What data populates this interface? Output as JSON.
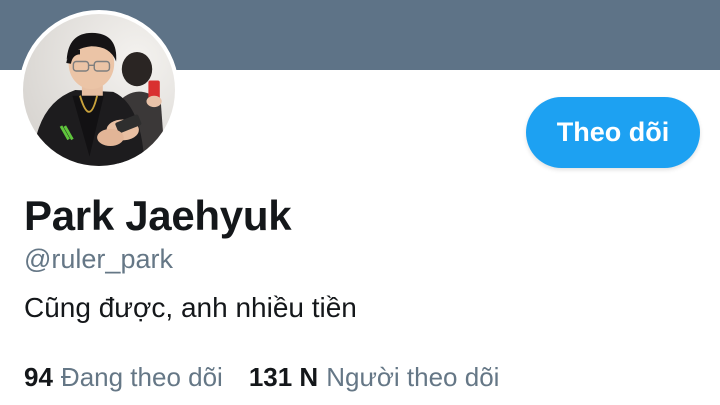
{
  "colors": {
    "banner": "#5e7387",
    "accent": "#1da1f2",
    "text_primary": "#14171a",
    "text_secondary": "#657786"
  },
  "profile": {
    "avatar_icon": "profile-photo",
    "name": "Park Jaehyuk",
    "handle": "@ruler_park",
    "bio": "Cũng được, anh nhiều tiền",
    "follow_label": "Theo dõi"
  },
  "stats": {
    "following_count": "94",
    "following_label": "Đang theo dõi",
    "followers_count": "131 N",
    "followers_label": "Người theo dõi"
  }
}
